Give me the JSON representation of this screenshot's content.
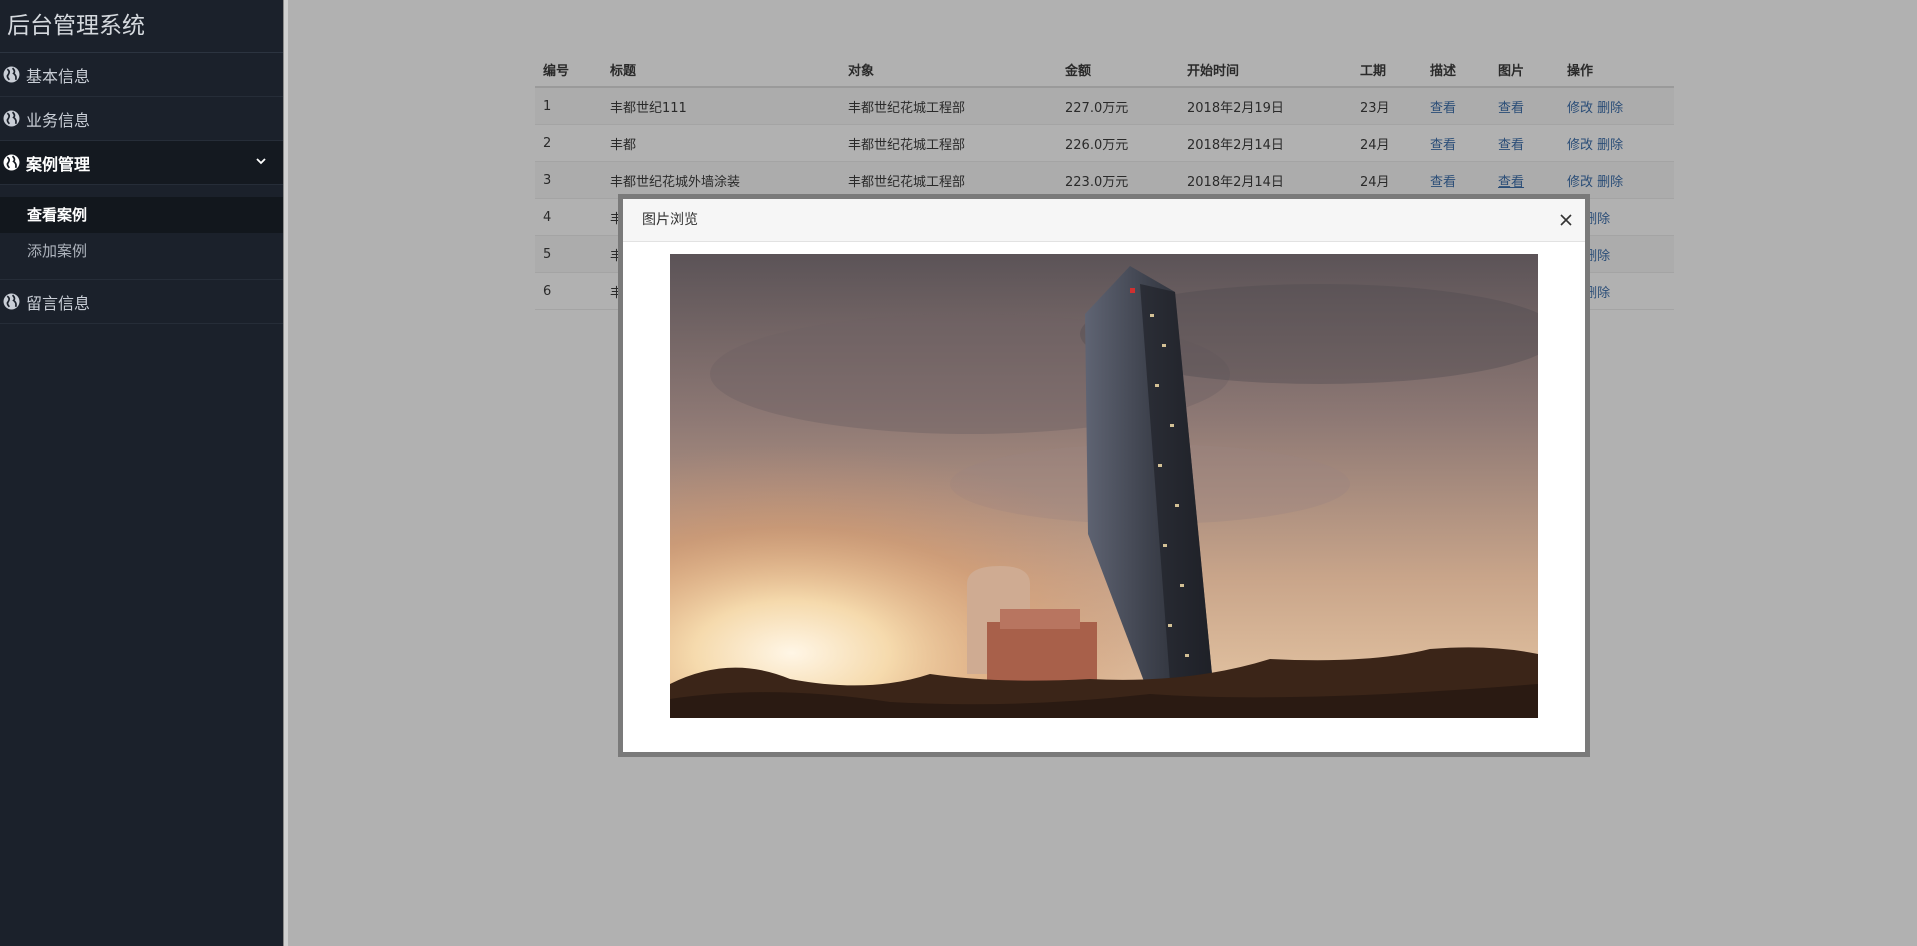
{
  "sidebar": {
    "brand": "后台管理系统",
    "items": [
      {
        "label": "基本信息",
        "icon": "globe-icon"
      },
      {
        "label": "业务信息",
        "icon": "globe-icon"
      },
      {
        "label": "案例管理",
        "icon": "globe-icon",
        "expanded": true
      },
      {
        "label": "留言信息",
        "icon": "globe-icon"
      }
    ],
    "submenu": [
      {
        "label": "查看案例",
        "active": true
      },
      {
        "label": "添加案例",
        "active": false
      }
    ]
  },
  "table": {
    "headers": [
      "编号",
      "标题",
      "对象",
      "金额",
      "开始时间",
      "工期",
      "描述",
      "图片",
      "操作"
    ],
    "view_label": "查看",
    "edit_label": "修改",
    "delete_label": "删除",
    "rows": [
      {
        "id": "1",
        "title": "丰都世纪111",
        "target": "丰都世纪花城工程部",
        "amount": "227.0万元",
        "start": "2018年2月19日",
        "period": "23月"
      },
      {
        "id": "2",
        "title": "丰都",
        "target": "丰都世纪花城工程部",
        "amount": "226.0万元",
        "start": "2018年2月14日",
        "period": "24月"
      },
      {
        "id": "3",
        "title": "丰都世纪花城外墙涂装",
        "target": "丰都世纪花城工程部",
        "amount": "223.0万元",
        "start": "2018年2月14日",
        "period": "24月"
      },
      {
        "id": "4",
        "title": "丰",
        "target": "",
        "amount": "",
        "start": "",
        "period": ""
      },
      {
        "id": "5",
        "title": "丰",
        "target": "",
        "amount": "",
        "start": "",
        "period": ""
      },
      {
        "id": "6",
        "title": "丰",
        "target": "",
        "amount": "",
        "start": "",
        "period": ""
      }
    ],
    "partial_edit_label": "改"
  },
  "modal": {
    "title": "图片浏览",
    "close_icon": "close-icon"
  }
}
